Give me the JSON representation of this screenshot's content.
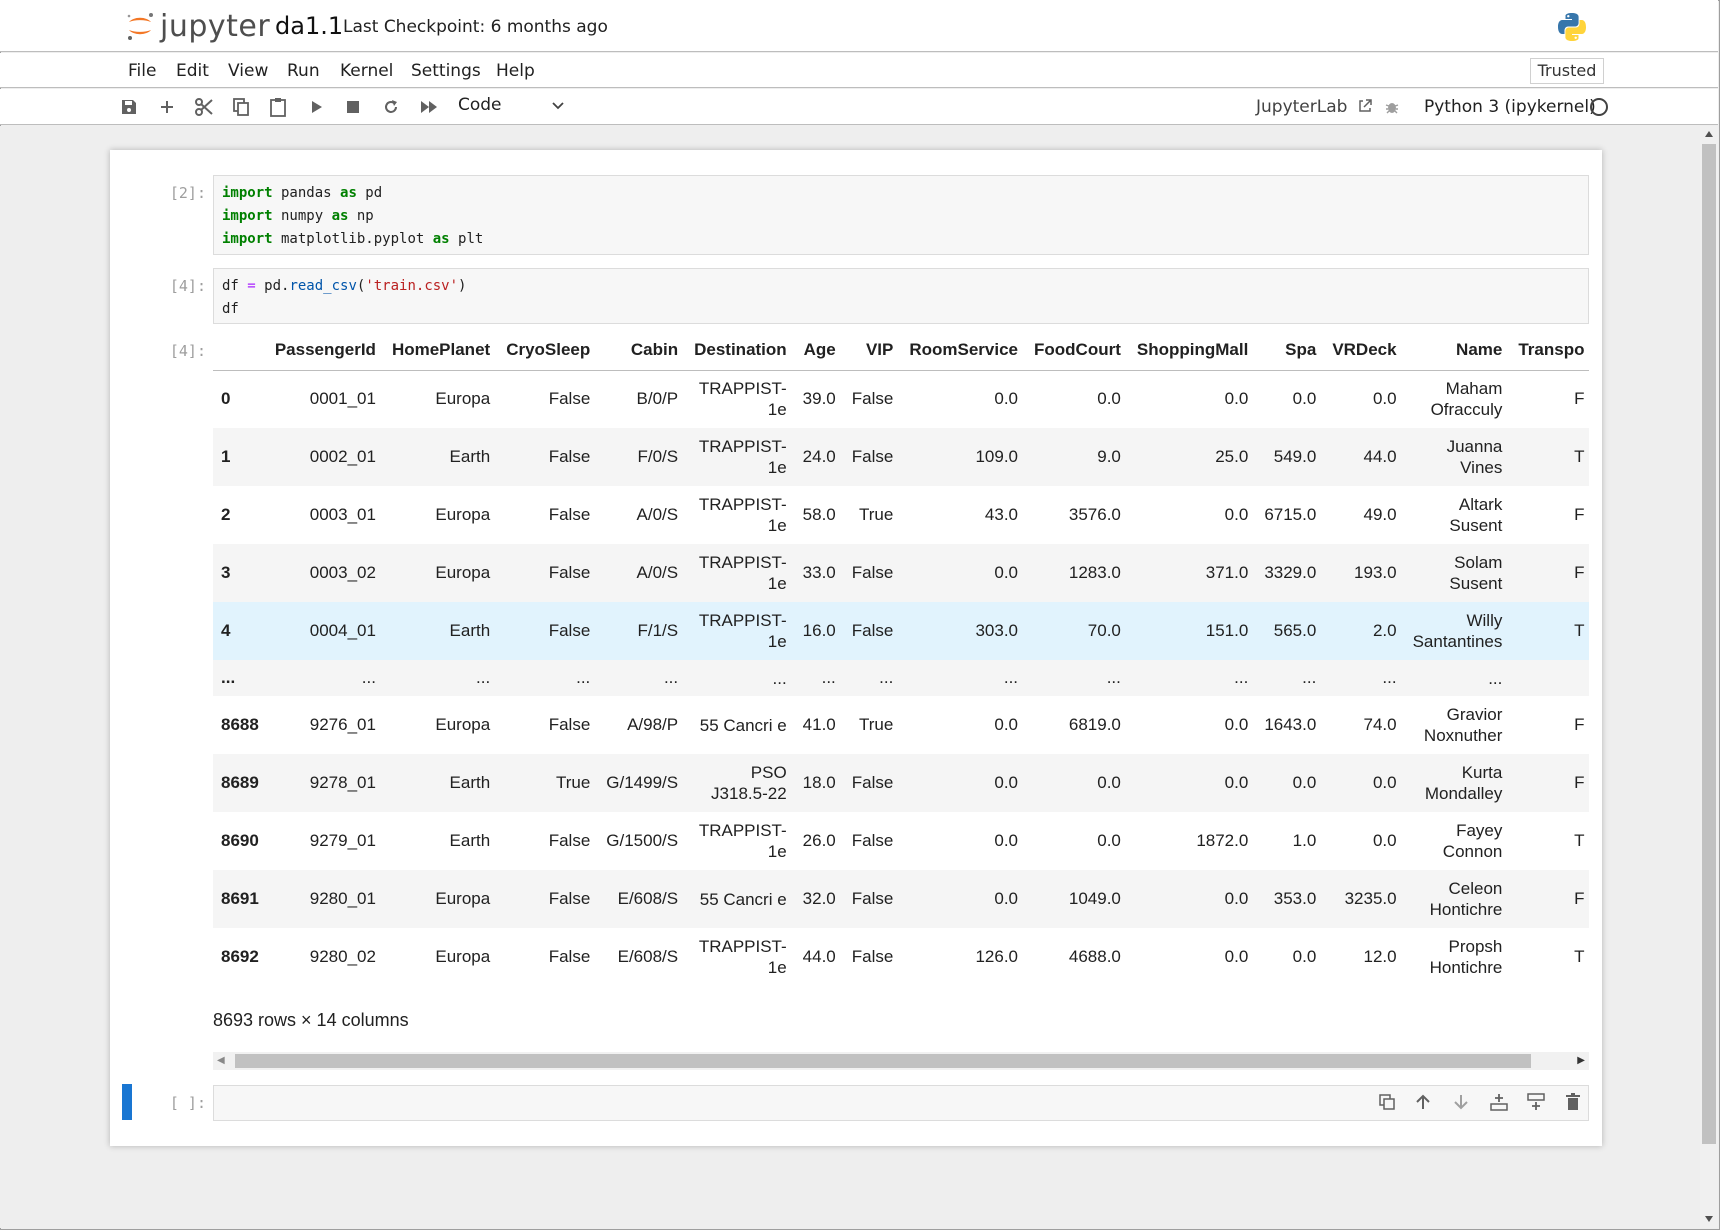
{
  "header": {
    "logo_text": "jupyter",
    "notebook_title": "da1.1",
    "checkpoint": "Last Checkpoint: 6 months ago"
  },
  "menu": [
    "File",
    "Edit",
    "View",
    "Run",
    "Kernel",
    "Settings",
    "Help"
  ],
  "trusted_label": "Trusted",
  "toolbar": {
    "icons": [
      "save-icon",
      "add-icon",
      "cut-icon",
      "copy-icon",
      "paste-icon",
      "run-icon",
      "stop-icon",
      "restart-icon",
      "fast-forward-icon"
    ],
    "cell_type": "Code",
    "jupyterlab_label": "JupyterLab",
    "kernel_name": "Python 3 (ipykernel)"
  },
  "cells": [
    {
      "prompt": "[2]:",
      "lines": [
        "import pandas as pd",
        "import numpy as np",
        "import matplotlib.pyplot as plt"
      ]
    },
    {
      "prompt": "[4]:",
      "lines": [
        "df = pd.read_csv('train.csv')",
        "df"
      ]
    },
    {
      "prompt": "[4]:"
    },
    {
      "prompt": "[ ]:"
    }
  ],
  "table": {
    "columns": [
      "",
      "PassengerId",
      "HomePlanet",
      "CryoSleep",
      "Cabin",
      "Destination",
      "Age",
      "VIP",
      "RoomService",
      "FoodCourt",
      "ShoppingMall",
      "Spa",
      "VRDeck",
      "Name",
      "Transpo"
    ],
    "rows": [
      [
        "0",
        "0001_01",
        "Europa",
        "False",
        "B/0/P",
        "TRAPPIST-1e",
        "39.0",
        "False",
        "0.0",
        "0.0",
        "0.0",
        "0.0",
        "0.0",
        "Maham Ofracculy",
        "F"
      ],
      [
        "1",
        "0002_01",
        "Earth",
        "False",
        "F/0/S",
        "TRAPPIST-1e",
        "24.0",
        "False",
        "109.0",
        "9.0",
        "25.0",
        "549.0",
        "44.0",
        "Juanna Vines",
        "T"
      ],
      [
        "2",
        "0003_01",
        "Europa",
        "False",
        "A/0/S",
        "TRAPPIST-1e",
        "58.0",
        "True",
        "43.0",
        "3576.0",
        "0.0",
        "6715.0",
        "49.0",
        "Altark Susent",
        "F"
      ],
      [
        "3",
        "0003_02",
        "Europa",
        "False",
        "A/0/S",
        "TRAPPIST-1e",
        "33.0",
        "False",
        "0.0",
        "1283.0",
        "371.0",
        "3329.0",
        "193.0",
        "Solam Susent",
        "F"
      ],
      [
        "4",
        "0004_01",
        "Earth",
        "False",
        "F/1/S",
        "TRAPPIST-1e",
        "16.0",
        "False",
        "303.0",
        "70.0",
        "151.0",
        "565.0",
        "2.0",
        "Willy Santantines",
        "T"
      ],
      [
        "...",
        "...",
        "...",
        "...",
        "...",
        "...",
        "...",
        "...",
        "...",
        "...",
        "...",
        "...",
        "...",
        "...",
        ""
      ],
      [
        "8688",
        "9276_01",
        "Europa",
        "False",
        "A/98/P",
        "55 Cancri e",
        "41.0",
        "True",
        "0.0",
        "6819.0",
        "0.0",
        "1643.0",
        "74.0",
        "Gravior Noxnuther",
        "F"
      ],
      [
        "8689",
        "9278_01",
        "Earth",
        "True",
        "G/1499/S",
        "PSO J318.5-22",
        "18.0",
        "False",
        "0.0",
        "0.0",
        "0.0",
        "0.0",
        "0.0",
        "Kurta Mondalley",
        "F"
      ],
      [
        "8690",
        "9279_01",
        "Earth",
        "False",
        "G/1500/S",
        "TRAPPIST-1e",
        "26.0",
        "False",
        "0.0",
        "0.0",
        "1872.0",
        "1.0",
        "0.0",
        "Fayey Connon",
        "T"
      ],
      [
        "8691",
        "9280_01",
        "Europa",
        "False",
        "E/608/S",
        "55 Cancri e",
        "32.0",
        "False",
        "0.0",
        "1049.0",
        "0.0",
        "353.0",
        "3235.0",
        "Celeon Hontichre",
        "F"
      ],
      [
        "8692",
        "9280_02",
        "Europa",
        "False",
        "E/608/S",
        "TRAPPIST-1e",
        "44.0",
        "False",
        "126.0",
        "4688.0",
        "0.0",
        "0.0",
        "12.0",
        "Propsh Hontichre",
        "T"
      ]
    ],
    "summary": "8693 rows × 14 columns"
  },
  "cell_actions": [
    "duplicate-icon",
    "move-up-icon",
    "move-down-icon",
    "insert-above-icon",
    "insert-below-icon",
    "delete-icon"
  ]
}
